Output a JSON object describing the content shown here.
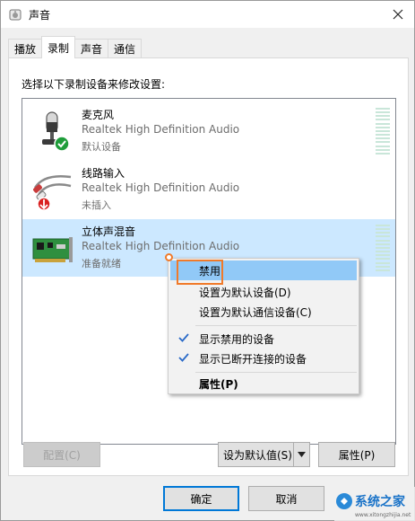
{
  "window": {
    "title": "声音"
  },
  "tabs": [
    "播放",
    "录制",
    "声音",
    "通信"
  ],
  "instruction": "选择以下录制设备来修改设置:",
  "devices": [
    {
      "name": "麦克风",
      "driver": "Realtek High Definition Audio",
      "status": "默认设备",
      "badge": "default"
    },
    {
      "name": "线路输入",
      "driver": "Realtek High Definition Audio",
      "status": "未插入",
      "badge": "unplugged"
    },
    {
      "name": "立体声混音",
      "driver": "Realtek High Definition Audio",
      "status": "准备就绪",
      "badge": "none",
      "selected": true
    }
  ],
  "context_menu": {
    "items": [
      {
        "label": "禁用",
        "highlighted": true
      },
      {
        "label": "设置为默认设备(D)"
      },
      {
        "label": "设置为默认通信设备(C)"
      },
      {
        "label": "显示禁用的设备",
        "checked": true
      },
      {
        "label": "显示已断开连接的设备",
        "checked": true
      },
      {
        "label": "属性(P)",
        "bold": true
      }
    ]
  },
  "buttons": {
    "configure": "配置(C)",
    "set_default": "设为默认值(S)",
    "properties": "属性(P)",
    "ok": "确定",
    "cancel": "取消"
  },
  "watermark": {
    "text": "系统之家",
    "url": "www.xitongzhijia.net"
  },
  "colors": {
    "selection": "#cce8ff",
    "menu_highlight": "#91c9f7",
    "callout": "#f07a2a",
    "default_badge": "#1f9d3a",
    "unplugged_badge": "#d92020"
  }
}
